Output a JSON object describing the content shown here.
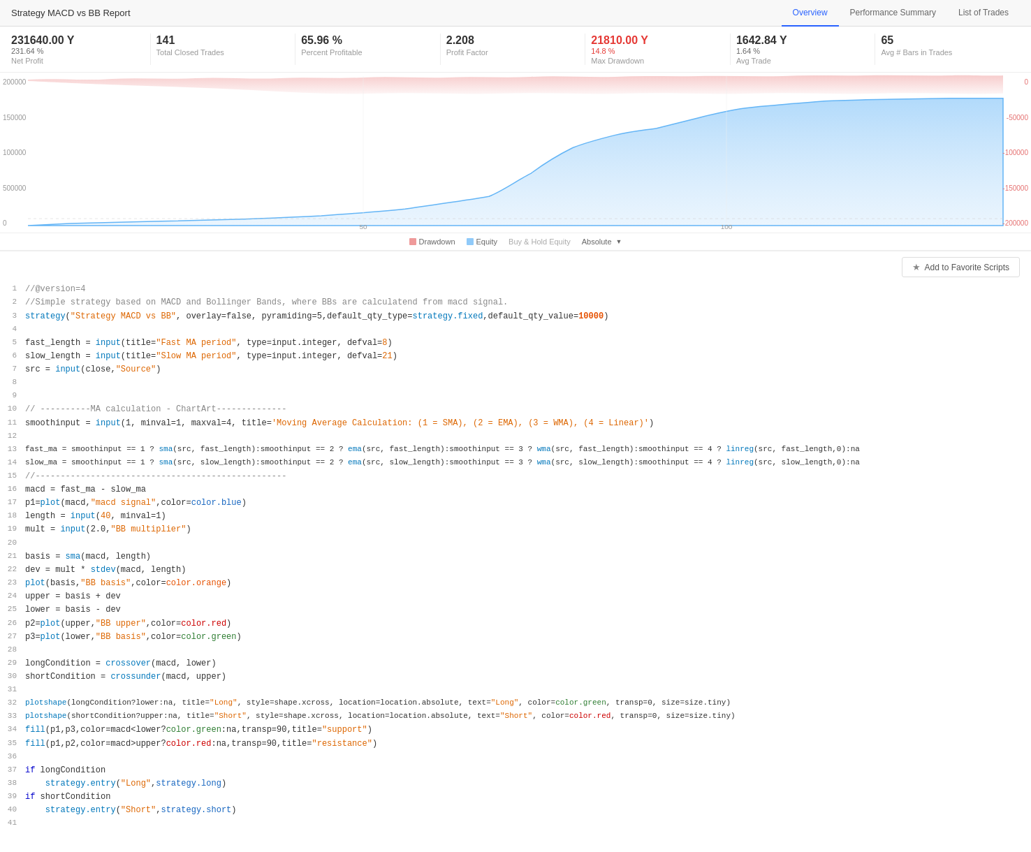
{
  "header": {
    "title": "Strategy MACD vs BB Report",
    "tabs": [
      {
        "id": "overview",
        "label": "Overview",
        "active": true
      },
      {
        "id": "performance",
        "label": "Performance Summary",
        "active": false
      },
      {
        "id": "trades",
        "label": "List of Trades",
        "active": false
      }
    ]
  },
  "stats": [
    {
      "id": "net-profit",
      "value": "231640.00 Y",
      "sub": "231.64 %",
      "label": "Net Profit",
      "red": false
    },
    {
      "id": "total-trades",
      "value": "141",
      "sub": "",
      "label": "Total Closed Trades",
      "red": false
    },
    {
      "id": "percent-profitable",
      "value": "65.96 %",
      "sub": "",
      "label": "Percent Profitable",
      "red": false
    },
    {
      "id": "profit-factor",
      "value": "2.208",
      "sub": "",
      "label": "Profit Factor",
      "red": false
    },
    {
      "id": "max-drawdown",
      "value": "21810.00 Y",
      "sub": "14.8 %",
      "label": "Max Drawdown",
      "red": true
    },
    {
      "id": "avg-trade",
      "value": "1642.84 Y",
      "sub": "1.64 %",
      "label": "Avg Trade",
      "red": false
    },
    {
      "id": "avg-bars",
      "value": "65",
      "sub": "",
      "label": "Avg # Bars in Trades",
      "red": false
    }
  ],
  "chart": {
    "y_labels_left": [
      "200000",
      "150000",
      "100000",
      "500000",
      "0"
    ],
    "y_labels_right": [
      "0",
      "-50000",
      "-100000",
      "-150000",
      "-200000"
    ],
    "x_labels": [
      "50",
      "100"
    ],
    "legend": [
      {
        "id": "drawdown",
        "label": "Drawdown",
        "color": "red"
      },
      {
        "id": "equity",
        "label": "Equity",
        "color": "blue"
      },
      {
        "id": "buy-hold",
        "label": "Buy & Hold Equity",
        "color": "gray"
      },
      {
        "id": "absolute",
        "label": "Absolute",
        "dropdown": true
      }
    ]
  },
  "toolbar": {
    "fav_label": "Add to Favorite Scripts"
  },
  "code": {
    "lines": [
      {
        "num": 1,
        "text": "//@version=4"
      },
      {
        "num": 2,
        "text": "//Simple strategy based on MACD and Bollinger Bands, where BBs are calculatend from macd signal."
      },
      {
        "num": 3,
        "text": "strategy(\"Strategy MACD vs BB\", overlay=false, pyramiding=5,default_qty_type=strategy.fixed,default_qty_value=10000)"
      },
      {
        "num": 4,
        "text": ""
      },
      {
        "num": 5,
        "text": "fast_length = input(title=\"Fast MA period\", type=input.integer, defval=8)"
      },
      {
        "num": 6,
        "text": "slow_length = input(title=\"Slow MA period\", type=input.integer, defval=21)"
      },
      {
        "num": 7,
        "text": "src = input(close,\"Source\")"
      },
      {
        "num": 8,
        "text": ""
      },
      {
        "num": 9,
        "text": ""
      },
      {
        "num": 10,
        "text": "// ----------MA calculation - ChartArt--------------"
      },
      {
        "num": 11,
        "text": "smoothinput = input(1, minval=1, maxval=4, title='Moving Average Calculation: (1 = SMA), (2 = EMA), (3 = WMA), (4 = Linear)')"
      },
      {
        "num": 12,
        "text": ""
      },
      {
        "num": 13,
        "text": "fast_ma = smoothinput == 1 ? sma(src, fast_length):smoothinput == 2 ? ema(src, fast_length):smoothinput == 3 ? wma(src, fast_length):smoothinput == 4 ? linreg(src, fast_length,0):na"
      },
      {
        "num": 14,
        "text": "slow_ma = smoothinput == 1 ? sma(src, slow_length):smoothinput == 2 ? ema(src, slow_length):smoothinput == 3 ? wma(src, slow_length):smoothinput == 4 ? linreg(src, slow_length,0):na"
      },
      {
        "num": 15,
        "text": "//--------------------------------------------------"
      },
      {
        "num": 16,
        "text": "macd = fast_ma - slow_ma"
      },
      {
        "num": 17,
        "text": "p1=plot(macd,\"macd signal\",color=color.blue)"
      },
      {
        "num": 18,
        "text": "length = input(40, minval=1)"
      },
      {
        "num": 19,
        "text": "mult = input(2.0,\"BB multiplier\")"
      },
      {
        "num": 20,
        "text": ""
      },
      {
        "num": 21,
        "text": "basis = sma(macd, length)"
      },
      {
        "num": 22,
        "text": "dev = mult * stdev(macd, length)"
      },
      {
        "num": 23,
        "text": "plot(basis,\"BB basis\",color=color.orange)"
      },
      {
        "num": 24,
        "text": "upper = basis + dev"
      },
      {
        "num": 25,
        "text": "lower = basis - dev"
      },
      {
        "num": 26,
        "text": "p2=plot(upper,\"BB upper\",color=color.red)"
      },
      {
        "num": 27,
        "text": "p3=plot(lower,\"BB basis\",color=color.green)"
      },
      {
        "num": 28,
        "text": ""
      },
      {
        "num": 29,
        "text": "longCondition = crossover(macd, lower)"
      },
      {
        "num": 30,
        "text": "shortCondition = crossunder(macd, upper)"
      },
      {
        "num": 31,
        "text": ""
      },
      {
        "num": 32,
        "text": "plotshape(longCondition?lower:na, title=\"Long\", style=shape.xcross, location=location.absolute, text=\"Long\", color=color.green, transp=0, size=size.tiny)"
      },
      {
        "num": 33,
        "text": "plotshape(shortCondition?upper:na, title=\"Short\", style=shape.xcross, location=location.absolute, text=\"Short\", color=color.red, transp=0, size=size.tiny)"
      },
      {
        "num": 34,
        "text": "fill(p1,p3,color=macd<lower?color.green:na,transp=90,title=\"support\")"
      },
      {
        "num": 35,
        "text": "fill(p1,p2,color=macd>upper?color.red:na,transp=90,title=\"resistance\")"
      },
      {
        "num": 36,
        "text": ""
      },
      {
        "num": 37,
        "text": "if longCondition"
      },
      {
        "num": 38,
        "text": "    strategy.entry(\"Long\",strategy.long)"
      },
      {
        "num": 39,
        "text": "if shortCondition"
      },
      {
        "num": 40,
        "text": "    strategy.entry(\"Short\",strategy.short)"
      },
      {
        "num": 41,
        "text": ""
      }
    ]
  }
}
